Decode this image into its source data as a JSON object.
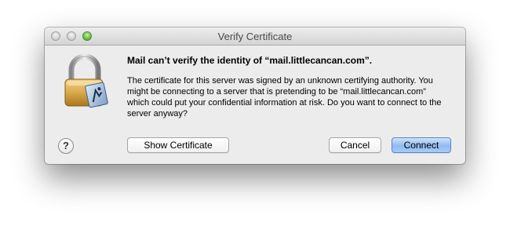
{
  "window": {
    "title": "Verify Certificate"
  },
  "dialog": {
    "heading": "Mail can’t verify the identity of “mail.littlecancan.com”.",
    "message": "The certificate for this server was signed by an unknown certifying authority. You might be connecting to a server that is pretending to be “mail.littlecancan.com” which could put your confidential information at risk. Do you want to connect to the server anyway?",
    "icon": "certificate-lock-icon"
  },
  "buttons": {
    "help": "?",
    "show_certificate": "Show Certificate",
    "cancel": "Cancel",
    "connect": "Connect"
  },
  "colors": {
    "default_button": "#8fbaf0",
    "zoom_button": "#5bb531"
  }
}
